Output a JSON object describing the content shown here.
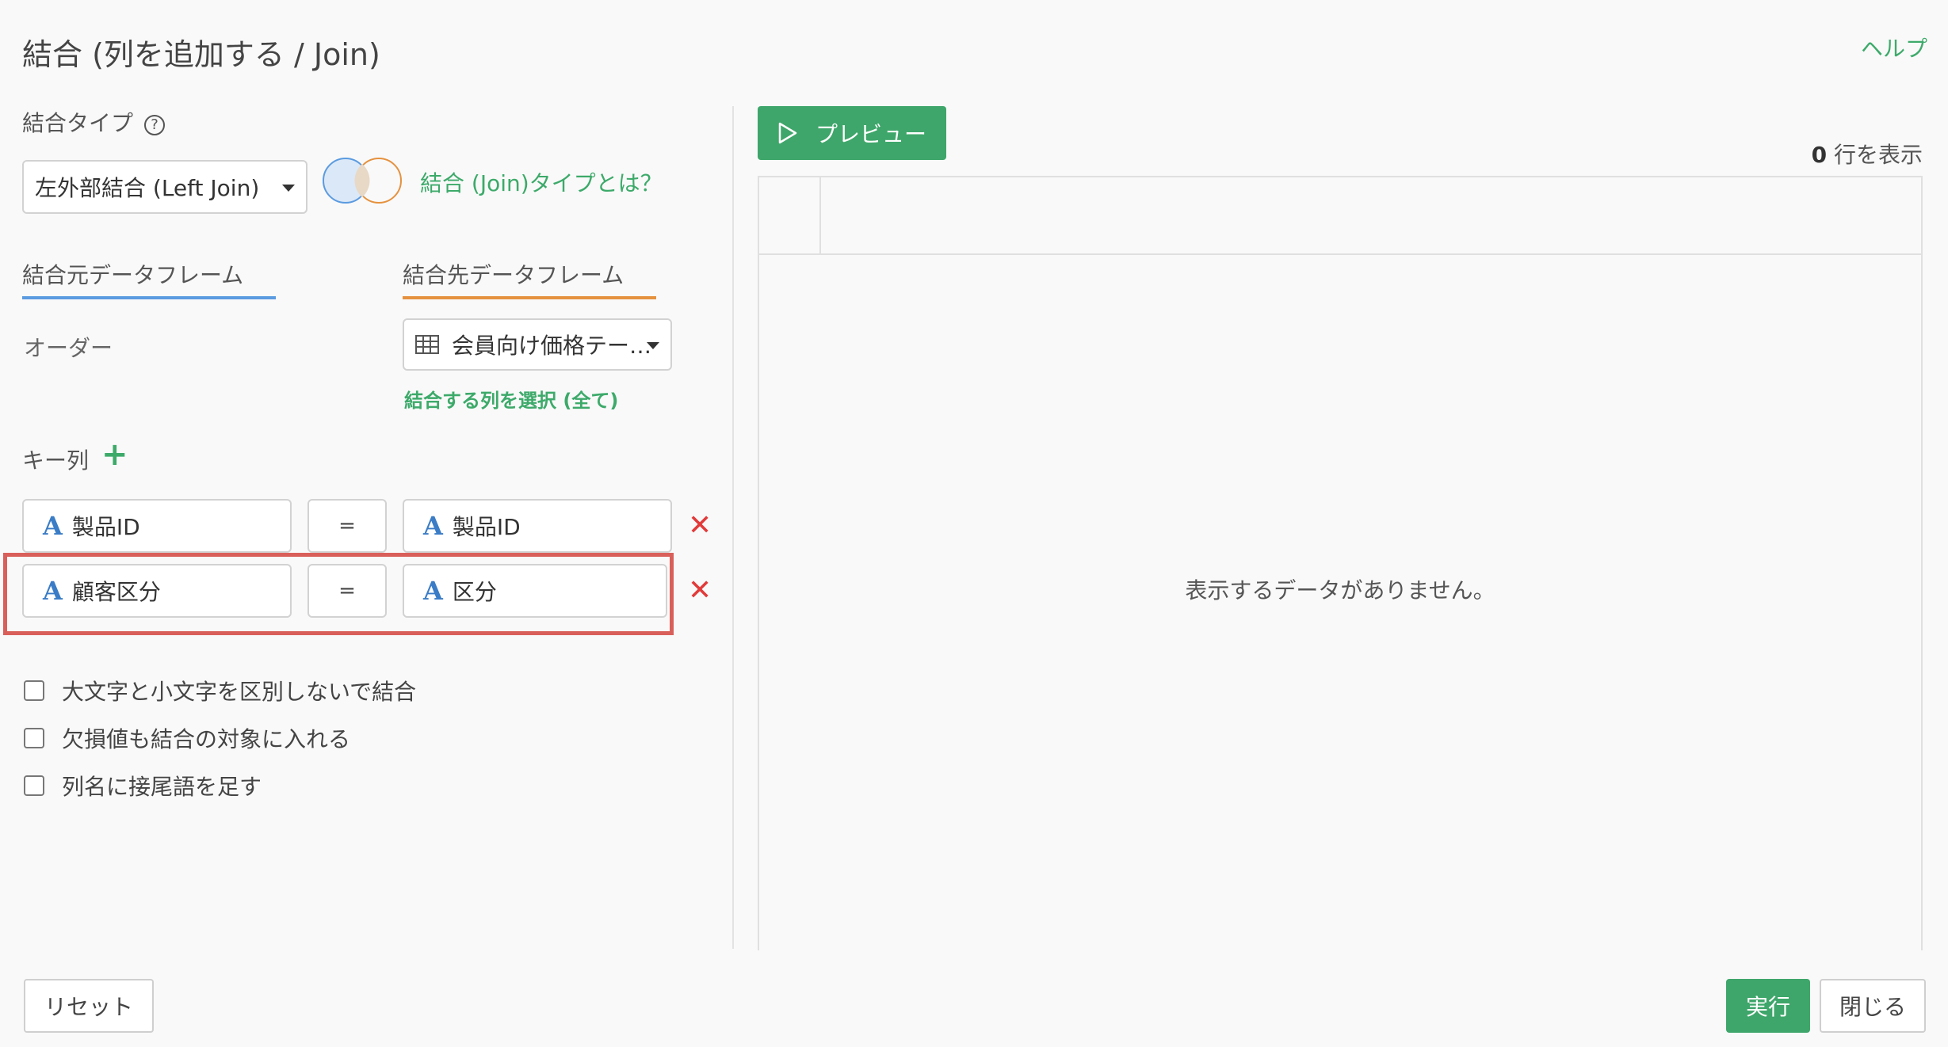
{
  "dialog": {
    "title": "結合 (列を追加する / Join)",
    "help_link": "ヘルプ"
  },
  "join_type": {
    "label": "結合タイプ",
    "help_icon": "?",
    "selected": "左外部結合 (Left Join)",
    "link": "結合 (Join)タイプとは？"
  },
  "tabs": {
    "source": "結合元データフレーム",
    "target": "結合先データフレーム"
  },
  "source_frame": "オーダー",
  "target_frame": {
    "selected": "会員向け価格テー…",
    "select_columns_link": "結合する列を選択 (全て)"
  },
  "key_columns": {
    "label": "キー列",
    "add_icon": "+",
    "rows": [
      {
        "left_type": "A",
        "left": "製品ID",
        "operator": "=",
        "right_type": "A",
        "right": "製品ID",
        "remove": "✕"
      },
      {
        "left_type": "A",
        "left": "顧客区分",
        "operator": "=",
        "right_type": "A",
        "right": "区分",
        "remove": "✕"
      }
    ]
  },
  "options": [
    {
      "label": "大文字と小文字を区別しないで結合",
      "checked": false
    },
    {
      "label": "欠損値も結合の対象に入れる",
      "checked": false
    },
    {
      "label": "列名に接尾語を足す",
      "checked": false
    }
  ],
  "preview": {
    "button": "プレビュー",
    "row_count": "0",
    "row_count_suffix": " 行を表示",
    "empty_message": "表示するデータがありません。"
  },
  "footer": {
    "reset": "リセット",
    "run": "実行",
    "close": "閉じる"
  },
  "colors": {
    "accent_green": "#3ea66a",
    "source_tab": "#5b9be0",
    "target_tab": "#e5923f",
    "remove_red": "#e23a3a",
    "highlight": "#d9605a"
  }
}
